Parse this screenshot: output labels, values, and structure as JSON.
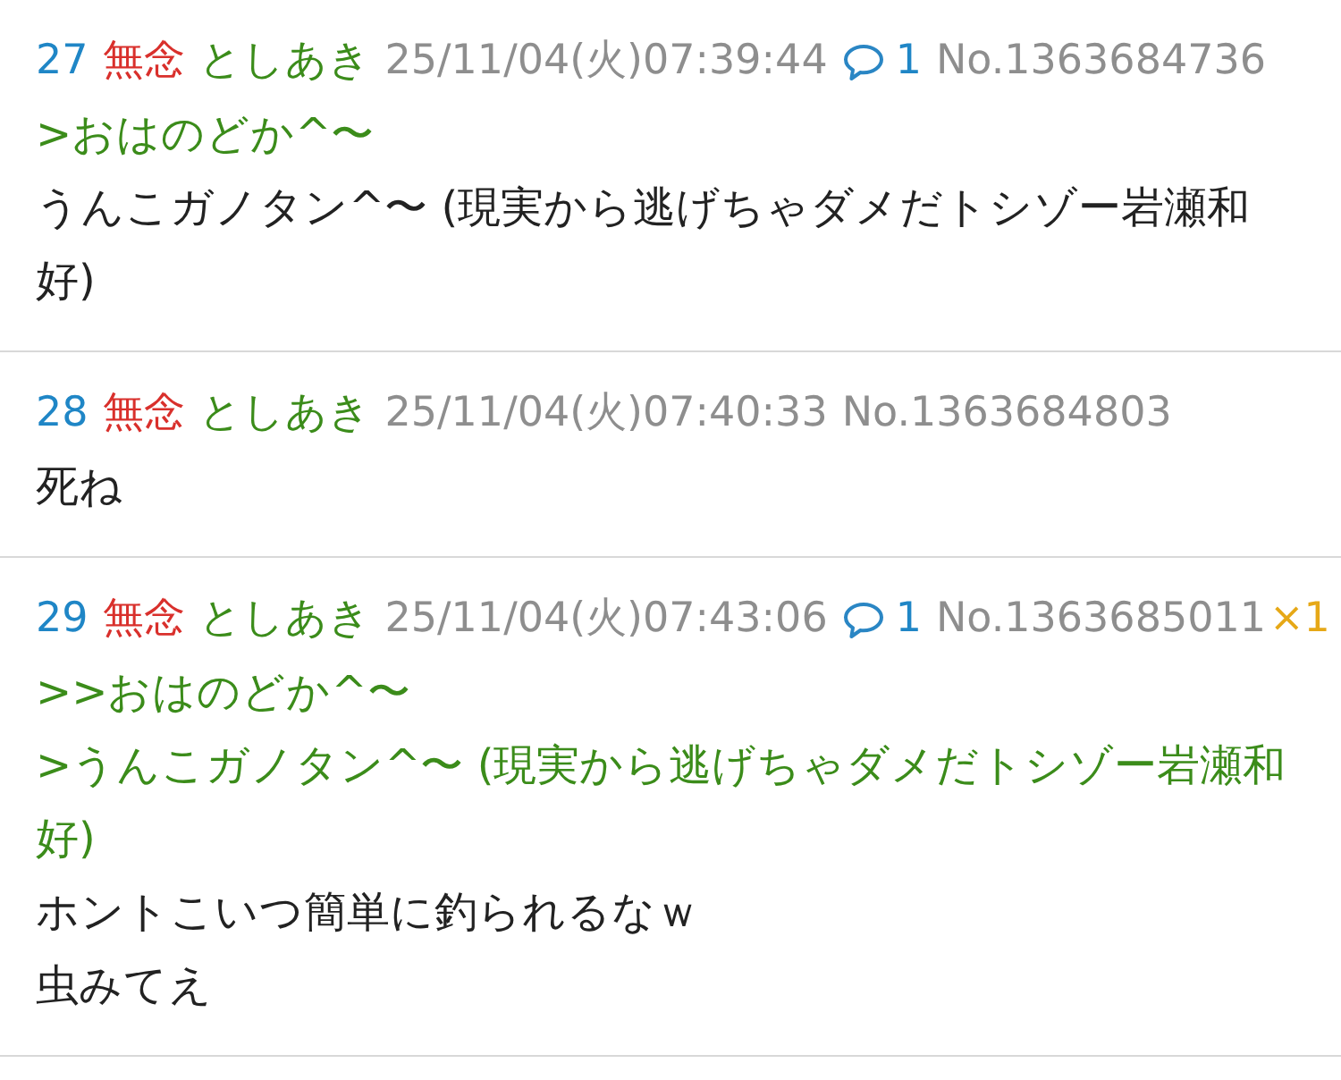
{
  "posts": [
    {
      "number": "27",
      "name": "無念",
      "handle": "としあき",
      "date": "25/11/04(火)07:39:44",
      "replies": "1",
      "post_no": "No.1363684736",
      "lines": [
        {
          "kind": "quote",
          "text": ">おはのどか^〜"
        },
        {
          "kind": "text",
          "text": "うんこガノタン^〜 (現実から逃げちゃダメだトシゾー岩瀬和好)"
        }
      ]
    },
    {
      "number": "28",
      "name": "無念",
      "handle": "としあき",
      "date": "25/11/04(火)07:40:33",
      "post_no": "No.1363684803",
      "lines": [
        {
          "kind": "text",
          "text": "死ね"
        }
      ]
    },
    {
      "number": "29",
      "name": "無念",
      "handle": "としあき",
      "date": "25/11/04(火)07:43:06",
      "replies": "1",
      "post_no": "No.1363685011",
      "likes": "×1",
      "lines": [
        {
          "kind": "quote",
          "text": ">>おはのどか^〜"
        },
        {
          "kind": "quote",
          "text": ">うんこガノタン^〜 (現実から逃げちゃダメだトシゾー岩瀬和好)"
        },
        {
          "kind": "text",
          "text": "ホントこいつ簡単に釣られるなｗ"
        },
        {
          "kind": "text",
          "text": "虫みてえ"
        }
      ]
    }
  ]
}
